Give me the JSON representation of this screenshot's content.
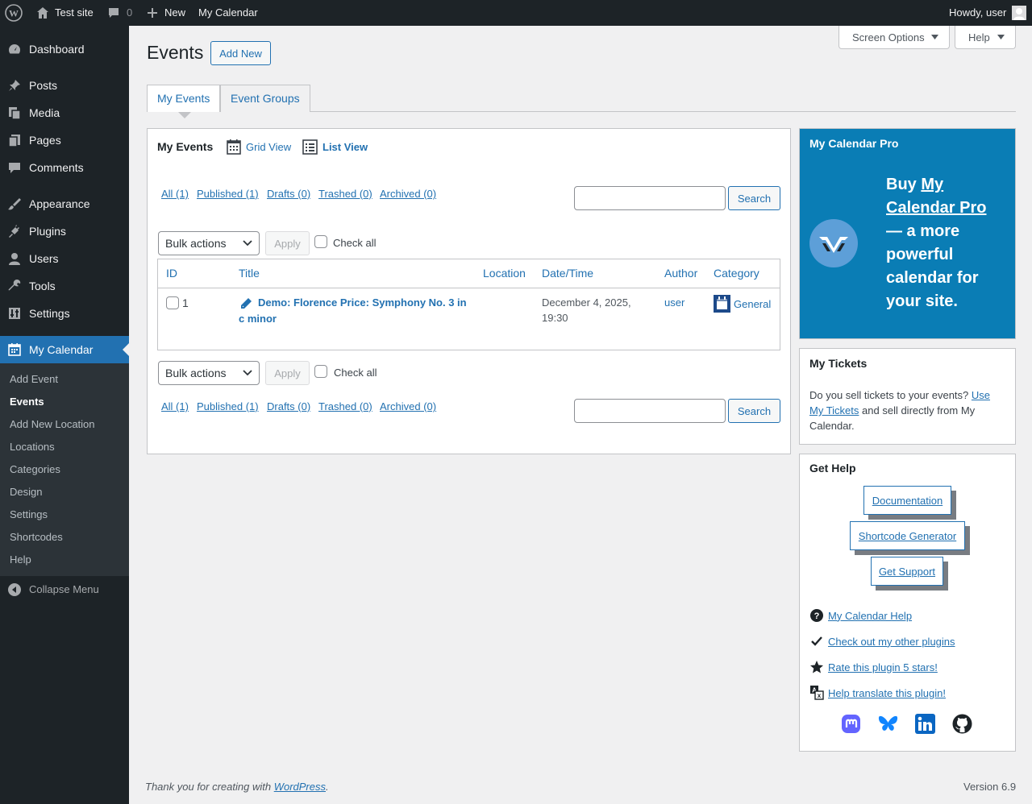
{
  "admin_bar": {
    "site_name": "Test site",
    "comments_count": "0",
    "new_label": "New",
    "calendar_label": "My Calendar",
    "greeting": "Howdy, user"
  },
  "sidebar": {
    "items": [
      {
        "label": "Dashboard",
        "icon": "dashboard-icon"
      },
      {
        "label": "Posts",
        "icon": "pin-icon"
      },
      {
        "label": "Media",
        "icon": "media-icon"
      },
      {
        "label": "Pages",
        "icon": "pages-icon"
      },
      {
        "label": "Comments",
        "icon": "comment-icon"
      },
      {
        "label": "Appearance",
        "icon": "brush-icon"
      },
      {
        "label": "Plugins",
        "icon": "plug-icon"
      },
      {
        "label": "Users",
        "icon": "user-icon"
      },
      {
        "label": "Tools",
        "icon": "wrench-icon"
      },
      {
        "label": "Settings",
        "icon": "sliders-icon"
      },
      {
        "label": "My Calendar",
        "icon": "calendar-icon"
      }
    ],
    "submenu": [
      "Add Event",
      "Events",
      "Add New Location",
      "Locations",
      "Categories",
      "Design",
      "Settings",
      "Shortcodes",
      "Help"
    ],
    "collapse_label": "Collapse Menu"
  },
  "screen_meta": {
    "screen_options": "Screen Options",
    "help": "Help"
  },
  "page": {
    "title": "Events",
    "add_new": "Add New",
    "tabs": [
      "My Events",
      "Event Groups"
    ]
  },
  "events_panel": {
    "heading": "My Events",
    "grid_view": "Grid View",
    "list_view": "List View",
    "filters": [
      "All (1)",
      "Published (1)",
      "Drafts (0)",
      "Trashed (0)",
      "Archived (0)"
    ],
    "search_button": "Search",
    "search_value": "",
    "bulk_actions": "Bulk actions",
    "apply": "Apply",
    "check_all": "Check all",
    "columns": [
      "ID",
      "Title",
      "Location",
      "Date/Time",
      "Author",
      "Category"
    ],
    "rows": [
      {
        "id": "1",
        "title_line1": "Demo: Florence Price: Symphony No. 3 in",
        "title_line2": "c minor",
        "location": "",
        "datetime_line1": "December 4, 2025,",
        "datetime_line2": "19:30",
        "author": "user",
        "category": "General"
      }
    ]
  },
  "pro_box": {
    "title": "My Calendar Pro",
    "text_buy": "Buy",
    "text_link_line1": "My",
    "text_link_line2": "Calendar Pro",
    "text_rest": [
      "— a more",
      "powerful",
      "calendar for",
      "your site."
    ],
    "bg_color": "#0a7db5"
  },
  "tickets_box": {
    "title": "My Tickets",
    "text1": "Do you sell tickets to your events?",
    "link_part1": "Use",
    "link_part2": "My Tickets",
    "text2": "and sell directly from My",
    "text3": "Calendar."
  },
  "help_box": {
    "title": "Get Help",
    "buttons": [
      "Documentation",
      "Shortcode Generator",
      "Get Support"
    ],
    "links": [
      {
        "label": "My Calendar Help",
        "icon": "question-icon"
      },
      {
        "label": "Check out my other plugins",
        "icon": "checkmark-icon"
      },
      {
        "label": "Rate this plugin 5 stars!",
        "icon": "star-icon"
      },
      {
        "label": "Help translate this plugin!",
        "icon": "translate-icon"
      }
    ],
    "social": [
      "mastodon-icon",
      "bluesky-icon",
      "linkedin-icon",
      "github-icon"
    ]
  },
  "footer": {
    "thanks": "Thank you for creating with",
    "wp_link": "WordPress",
    "period": ".",
    "version": "Version 6.9"
  },
  "colors": {
    "accent": "#2271b1",
    "sidebar_bg": "#1d2327",
    "submenu_bg": "#2c3338",
    "pro_bg": "#0a7db5"
  }
}
